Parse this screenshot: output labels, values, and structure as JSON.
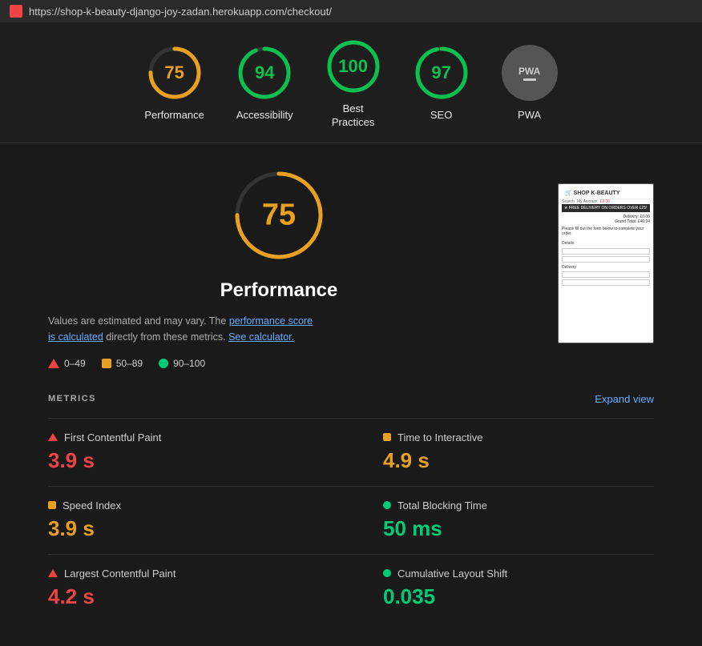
{
  "titlebar": {
    "url": "https://shop-k-beauty-django-joy-zadan.herokuapp.com/checkout/"
  },
  "scores": [
    {
      "id": "performance",
      "value": 75,
      "label": "Performance",
      "color": "#e8a020",
      "stroke_pct": 75
    },
    {
      "id": "accessibility",
      "value": 94,
      "label": "Accessibility",
      "color": "#0cc050",
      "stroke_pct": 94
    },
    {
      "id": "best-practices",
      "value": 100,
      "label": "Best\nPractices",
      "color": "#0cc050",
      "stroke_pct": 100
    },
    {
      "id": "seo",
      "value": 97,
      "label": "SEO",
      "color": "#0cc050",
      "stroke_pct": 97
    }
  ],
  "pwa": {
    "label": "PWA"
  },
  "main": {
    "big_score": 75,
    "title": "Performance",
    "description_start": "Values are estimated and may vary. The",
    "link1": "performance score\nis calculated",
    "description_mid": "directly from these metrics.",
    "link2": "See calculator.",
    "legend": {
      "low_label": "0–49",
      "mid_label": "50–89",
      "high_label": "90–100"
    }
  },
  "metrics": {
    "title": "METRICS",
    "expand_label": "Expand view",
    "items": [
      {
        "name": "First Contentful Paint",
        "value": "3.9 s",
        "type": "red"
      },
      {
        "name": "Time to Interactive",
        "value": "4.9 s",
        "type": "orange"
      },
      {
        "name": "Speed Index",
        "value": "3.9 s",
        "type": "orange"
      },
      {
        "name": "Total Blocking Time",
        "value": "50 ms",
        "type": "green"
      },
      {
        "name": "Largest Contentful Paint",
        "value": "4.2 s",
        "type": "red"
      },
      {
        "name": "Cumulative Layout Shift",
        "value": "0.035",
        "type": "green"
      }
    ]
  }
}
